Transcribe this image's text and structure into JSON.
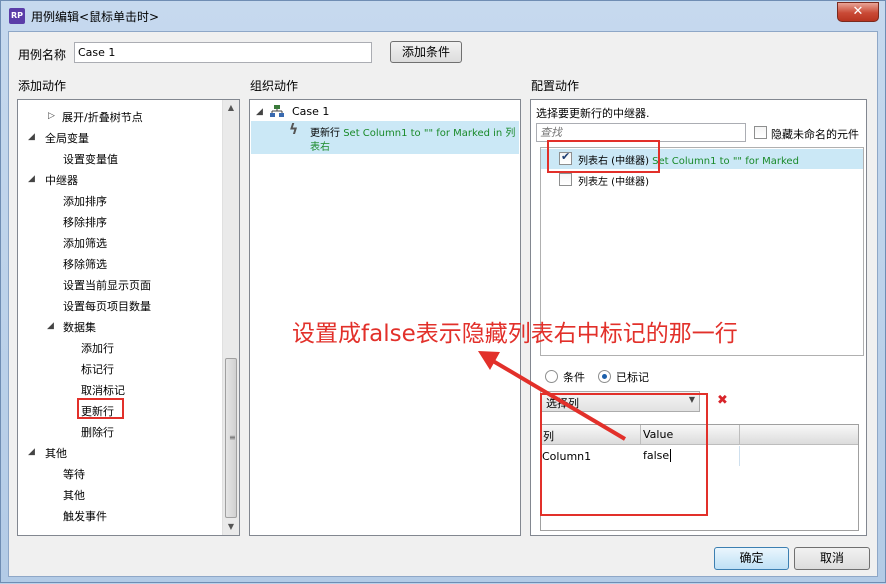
{
  "window": {
    "title": "用例编辑<鼠标单击时>",
    "app_icon": "RP",
    "close": "✕"
  },
  "case_name": {
    "label": "用例名称",
    "value": "Case 1",
    "add_condition": "添加条件"
  },
  "sections": {
    "add_action": "添加动作",
    "organize_action": "组织动作",
    "config_action": "配置动作"
  },
  "tree": [
    {
      "label": "展开/折叠树节点",
      "toggle": "▷"
    },
    {
      "label": "全局变量",
      "toggle": "◢"
    },
    {
      "label": "设置变量值"
    },
    {
      "label": "中继器",
      "toggle": "◢"
    },
    {
      "label": "添加排序"
    },
    {
      "label": "移除排序"
    },
    {
      "label": "添加筛选"
    },
    {
      "label": "移除筛选"
    },
    {
      "label": "设置当前显示页面"
    },
    {
      "label": "设置每页项目数量"
    },
    {
      "label": "数据集",
      "toggle": "◢"
    },
    {
      "label": "添加行"
    },
    {
      "label": "标记行"
    },
    {
      "label": "取消标记"
    },
    {
      "label": "更新行"
    },
    {
      "label": "删除行"
    },
    {
      "label": "其他",
      "toggle": "◢"
    },
    {
      "label": "等待"
    },
    {
      "label": "其他"
    },
    {
      "label": "触发事件"
    }
  ],
  "organize": {
    "case_label": "Case 1",
    "action_name": "更新行",
    "action_detail": "Set Column1 to \"\" for Marked in 列",
    "action_detail2": "表右"
  },
  "config": {
    "select_label": "选择要更新行的中继器.",
    "search_placeholder": "查找",
    "hide_unnamed": "隐藏未命名的元件",
    "repeaters": [
      {
        "name": "列表右 (中继器)",
        "detail": "Set Column1 to \"\" for Marked",
        "checked": true
      },
      {
        "name": "列表左 (中继器)",
        "detail": "",
        "checked": false
      }
    ],
    "radio_condition": "条件",
    "radio_marked": "已标记",
    "select_column": "选择列",
    "remove_icon": "✖",
    "table_headers": [
      "列",
      "Value"
    ],
    "table_rows": [
      {
        "column": "Column1",
        "value": "false"
      }
    ]
  },
  "annotation": "设置成false表示隐藏列表右中标记的那一行",
  "buttons": {
    "ok": "确定",
    "cancel": "取消"
  }
}
